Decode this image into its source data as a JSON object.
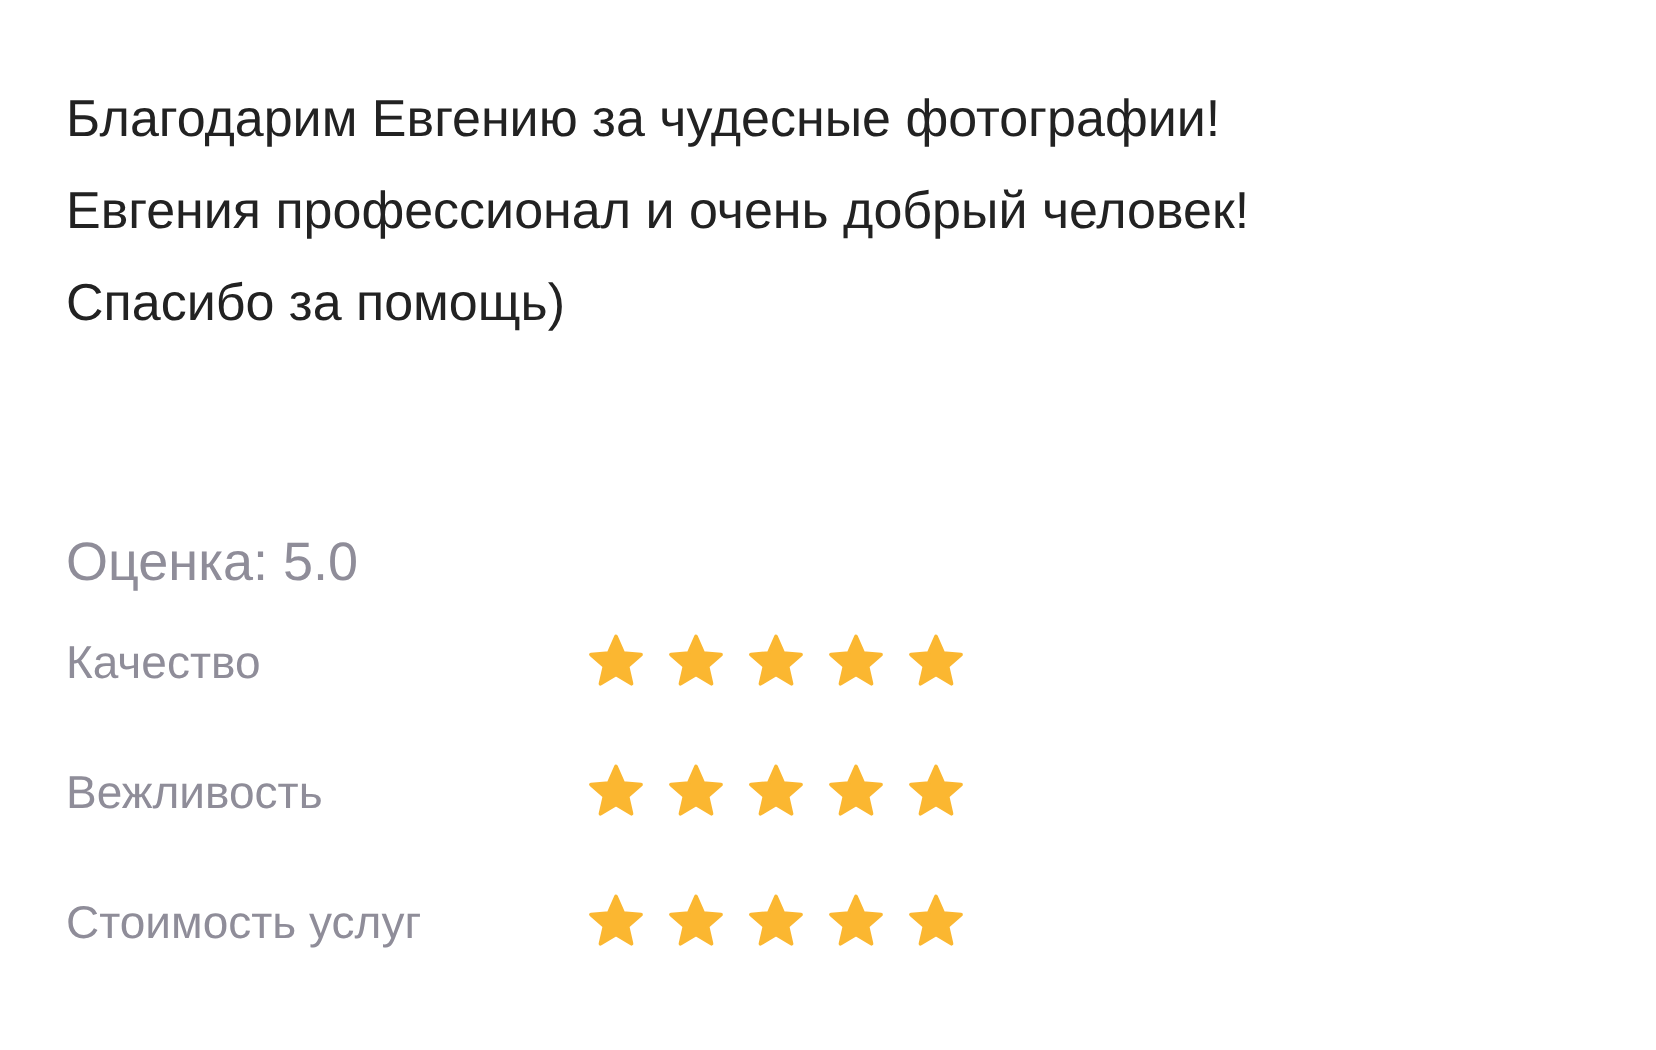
{
  "review": {
    "text_lines": [
      "Благодарим Евгению за чудесные фотографии!",
      "Евгения профессионал и очень добрый человек!",
      "Спасибо за помощь)"
    ]
  },
  "rating": {
    "summary": "Оценка: 5.0",
    "criteria": [
      {
        "label": "Качество",
        "stars": 5
      },
      {
        "label": "Вежливость",
        "stars": 5
      },
      {
        "label": "Стоимость услуг",
        "stars": 5
      }
    ]
  }
}
